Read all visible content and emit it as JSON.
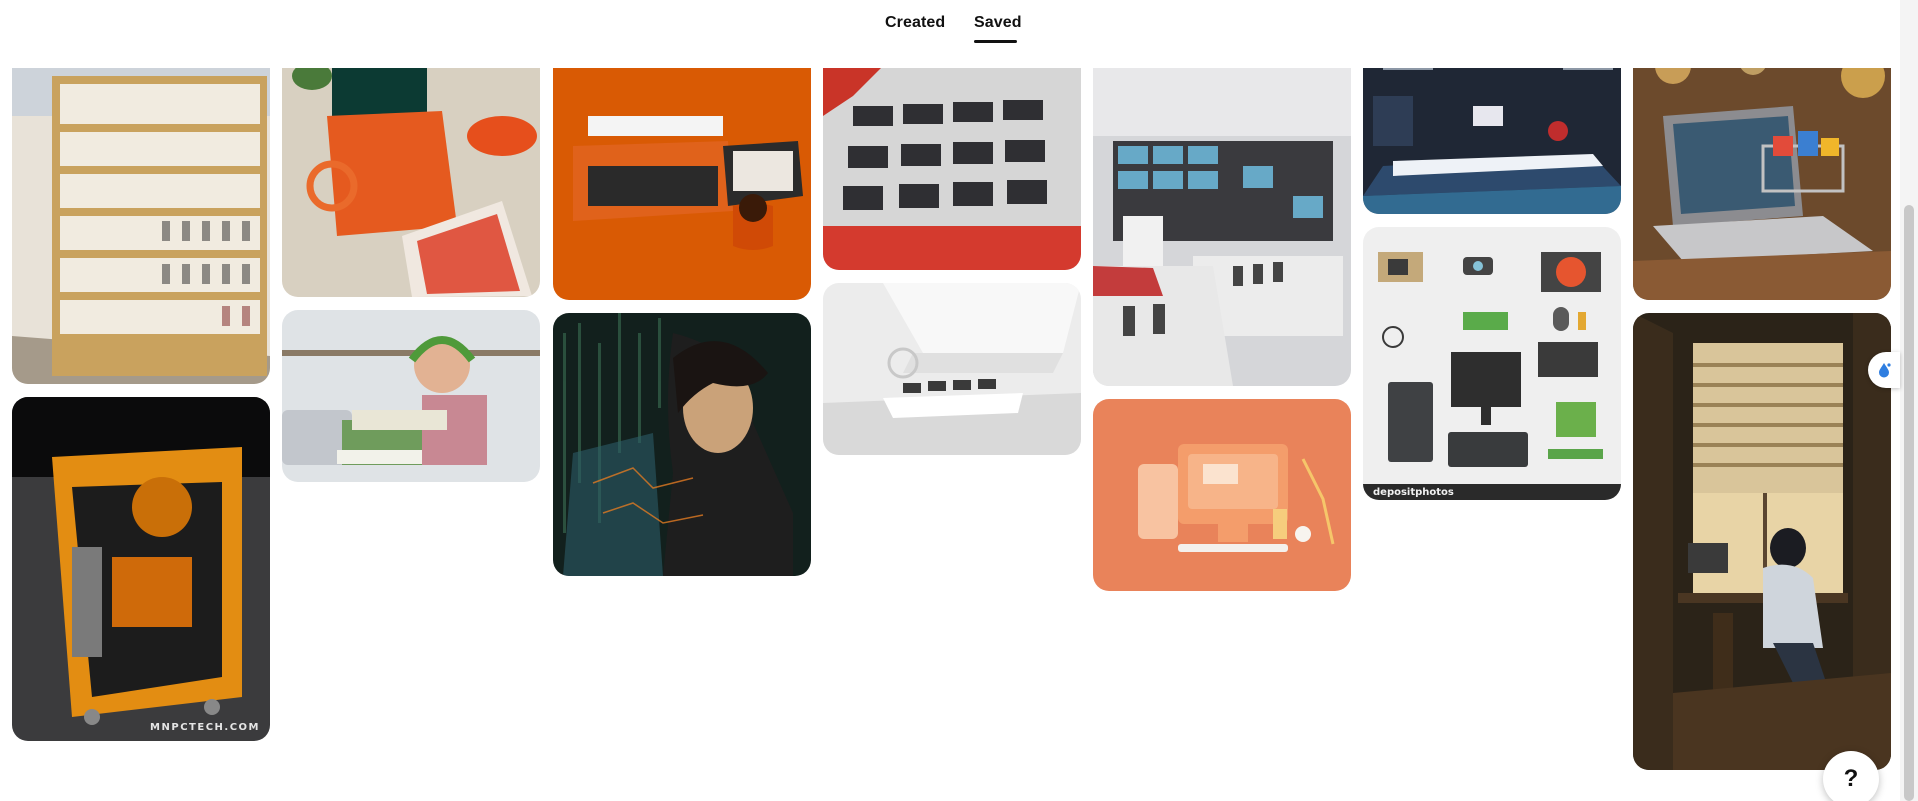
{
  "tabs": [
    {
      "label": "Created",
      "selected": false
    },
    {
      "label": "Saved",
      "selected": true
    }
  ],
  "pins": {
    "retail_shelves": {
      "description_icon": "store-shelves-photo"
    },
    "orange_pc_case": {
      "watermark": "MNPCTECH.COM"
    },
    "orange_laptop_flatlay": {
      "description_icon": "flatlay-photo"
    },
    "boy_studying": {
      "description_icon": "student-photo"
    },
    "orange_typewriter": {
      "description_icon": "typewriter-photo"
    },
    "anime_hacker": {
      "description_icon": "illustration"
    },
    "electronics_store_red": {
      "description_icon": "store-photo"
    },
    "modern_showroom": {
      "description_icon": "showroom-photo"
    },
    "electronics_showroom": {
      "description_icon": "showroom-photo"
    },
    "orange_desk_illustration": {
      "description_icon": "3d-illustration"
    },
    "blue_store": {
      "description_icon": "store-photo"
    },
    "pc_components": {
      "watermark": "depositphotos"
    },
    "shopping_laptop": {
      "description_icon": "ecommerce-illustration"
    },
    "anime_desk_window": {
      "description_icon": "illustration"
    }
  },
  "help": {
    "label": "?"
  },
  "colors": {
    "accent_orange": "#e8620d",
    "text": "#111111",
    "background": "#ffffff"
  }
}
